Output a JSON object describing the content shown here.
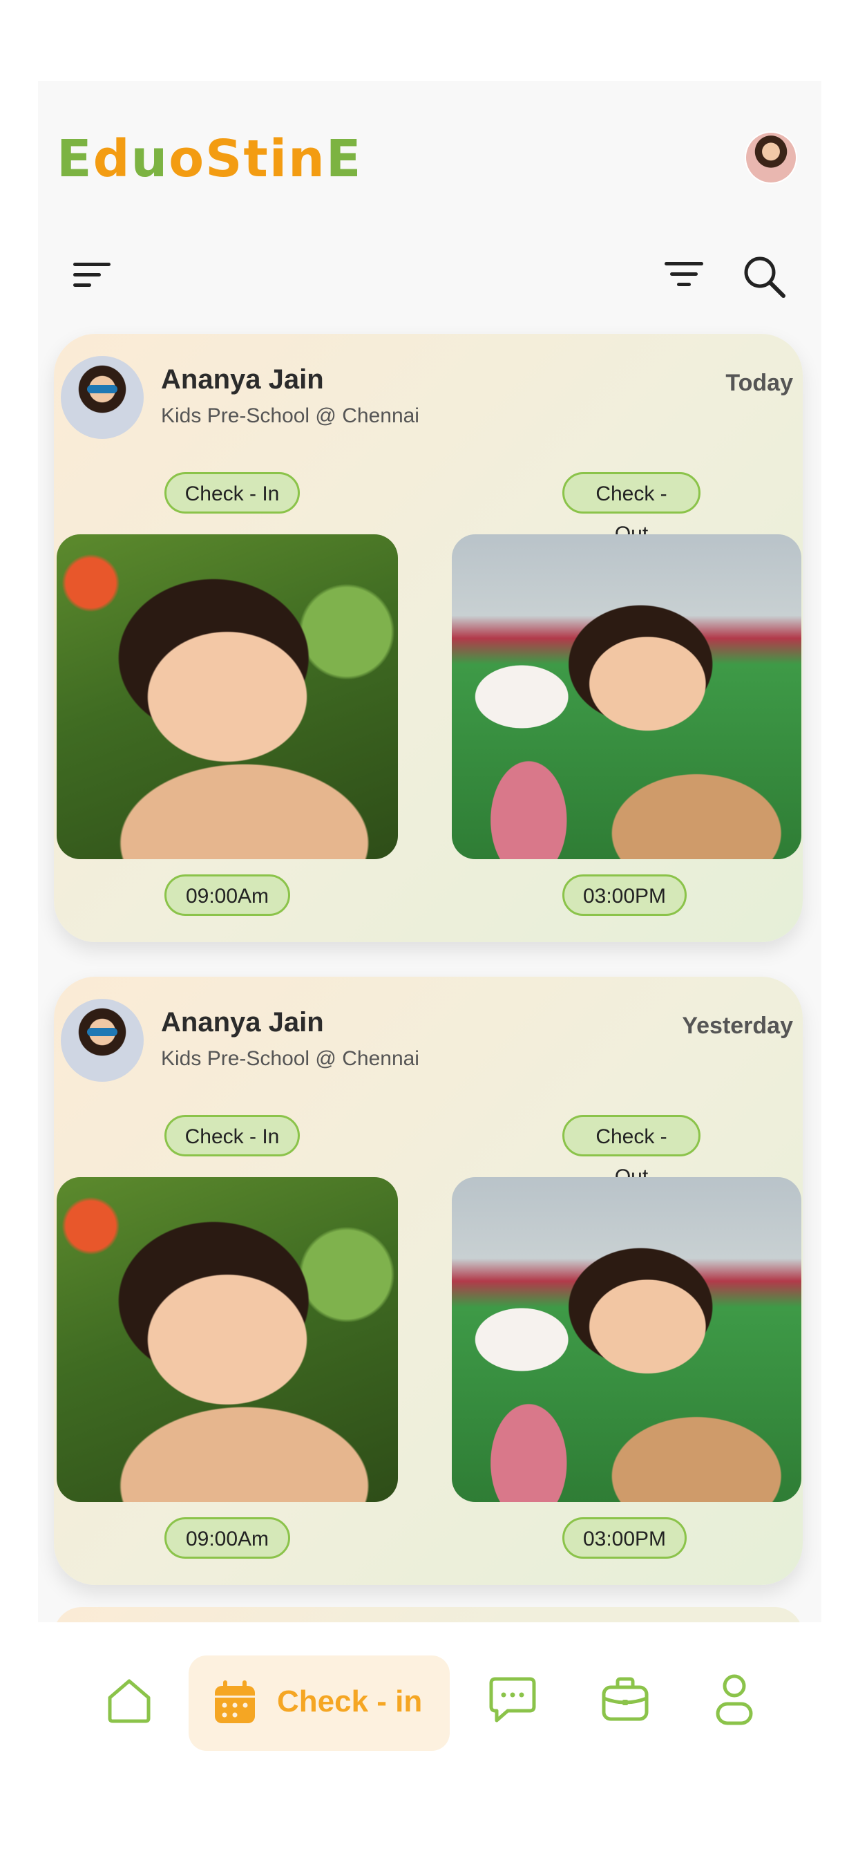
{
  "header": {
    "logo_text": "EduoStinE",
    "logo_letters": [
      "E",
      "d",
      "u",
      "o",
      "S",
      "t",
      "i",
      "n",
      "E"
    ]
  },
  "cards": [
    {
      "name": "Ananya Jain",
      "school": "Kids Pre-School @ Chennai",
      "day": "Today",
      "check_in_label": "Check - In",
      "check_out_label": "Check - Out",
      "check_in_time": "09:00Am",
      "check_out_time": "03:00PM"
    },
    {
      "name": "Ananya Jain",
      "school": "Kids Pre-School @ Chennai",
      "day": "Yesterday",
      "check_in_label": "Check - In",
      "check_out_label": "Check - Out",
      "check_in_time": "09:00Am",
      "check_out_time": "03:00PM"
    }
  ],
  "bottom_nav": {
    "active_label": "Check - in",
    "items": [
      "home-icon",
      "calendar-icon",
      "chat-icon",
      "briefcase-icon",
      "profile-icon"
    ]
  },
  "colors": {
    "accent_green": "#8bc34a",
    "accent_orange": "#f5a623",
    "pill_bg": "#d5e8b8"
  }
}
